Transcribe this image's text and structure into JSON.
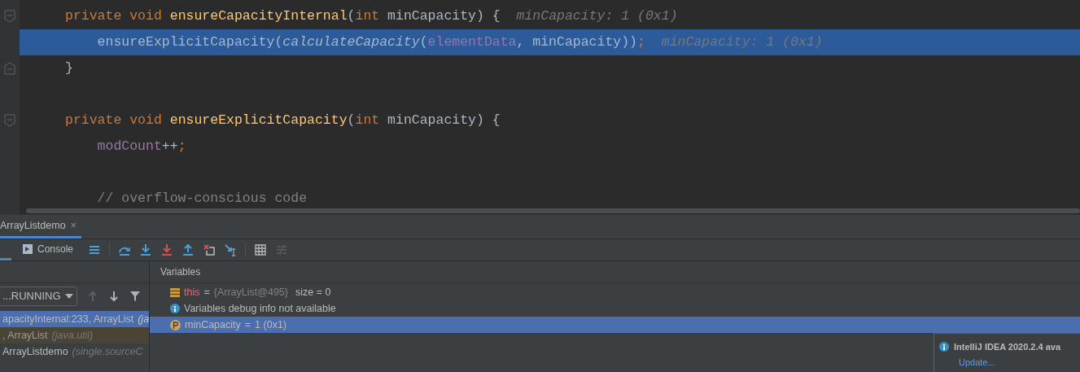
{
  "editor": {
    "lines": [
      {
        "fold_start": true,
        "fold_end": false,
        "indented": false,
        "highlighted": false,
        "tokens": [
          {
            "text": "private void ",
            "kind": "keyword"
          },
          {
            "text": "ensureCapacityInternal",
            "kind": "declaration"
          },
          {
            "text": "(",
            "kind": "plain"
          },
          {
            "text": "int",
            "kind": "keyword"
          },
          {
            "text": " minCapacity) {",
            "kind": "plain"
          },
          {
            "text": "minCapacity: 1 (0x1)",
            "kind": "hint"
          }
        ]
      },
      {
        "fold_start": false,
        "fold_end": false,
        "indented": true,
        "highlighted": true,
        "tokens": [
          {
            "text": "ensureExplicitCapacity(",
            "kind": "plain"
          },
          {
            "text": "calculateCapacity",
            "kind": "static_call"
          },
          {
            "text": "(",
            "kind": "plain"
          },
          {
            "text": "elementData",
            "kind": "field"
          },
          {
            "text": ", minCapacity))",
            "kind": "plain"
          },
          {
            "text": ";",
            "kind": "keyword"
          },
          {
            "text": "minCapacity: 1 (0x1)",
            "kind": "hint"
          }
        ]
      },
      {
        "fold_start": false,
        "fold_end": true,
        "indented": false,
        "highlighted": false,
        "tokens": [
          {
            "text": "}",
            "kind": "plain"
          }
        ]
      },
      {
        "fold_start": false,
        "fold_end": false,
        "highlighted": false
      },
      {
        "fold_start": true,
        "fold_end": false,
        "indented": false,
        "highlighted": false,
        "tokens": [
          {
            "text": "private void ",
            "kind": "keyword"
          },
          {
            "text": "ensureExplicitCapacity",
            "kind": "declaration"
          },
          {
            "text": "(",
            "kind": "plain"
          },
          {
            "text": "int",
            "kind": "keyword"
          },
          {
            "text": " minCapacity) {",
            "kind": "plain"
          }
        ]
      },
      {
        "fold_start": false,
        "fold_end": false,
        "indented": true,
        "highlighted": false,
        "tokens": [
          {
            "text": "modCount",
            "kind": "field"
          },
          {
            "text": "++",
            "kind": "plain"
          },
          {
            "text": ";",
            "kind": "keyword"
          }
        ]
      },
      {
        "fold_start": false,
        "fold_end": false,
        "highlighted": false
      },
      {
        "fold_start": false,
        "fold_end": false,
        "indented": true,
        "highlighted": false,
        "tokens": [
          {
            "text": "// overflow-conscious code",
            "kind": "comment"
          }
        ]
      }
    ]
  },
  "debug": {
    "session_tabs": [
      {
        "label": "ArrayListdemo",
        "selected": true,
        "close": "×"
      }
    ],
    "tabs": [
      {
        "label": "Console",
        "selected": false
      }
    ],
    "thread_dropdown": {
      "value": "...RUNNING"
    },
    "frames": [
      {
        "method": "apacityInternal:233, ArrayList",
        "package": "(ja",
        "selected": true,
        "kind": "user"
      },
      {
        "method": ", ArrayList",
        "package": "(java.util)",
        "selected": false,
        "kind": "library"
      },
      {
        "method": "ArrayListdemo",
        "package": "(single.sourceC",
        "selected": false,
        "kind": "user"
      }
    ],
    "variables_title": "Variables",
    "variables": [
      {
        "kind": "object",
        "name": "this",
        "equals": "=",
        "value": "{ArrayList@495}",
        "extra": "size = 0",
        "selected": false
      },
      {
        "kind": "info",
        "text": "Variables debug info not available",
        "selected": false
      },
      {
        "kind": "param",
        "name": "minCapacity",
        "equals": "=",
        "value": "1 (0x1)",
        "selected": true
      }
    ]
  },
  "notification": {
    "title": "IntelliJ IDEA 2020.2.4 ava",
    "link": "Update..."
  }
}
